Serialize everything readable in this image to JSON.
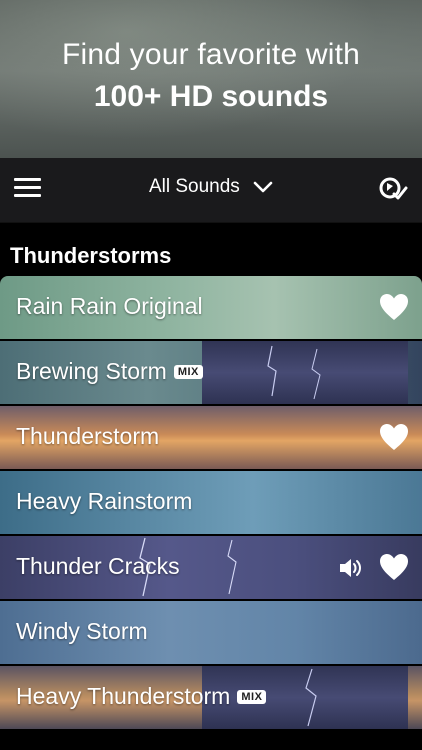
{
  "promo": {
    "line1": "Find your favorite with",
    "line2": "100+ HD sounds"
  },
  "navbar": {
    "title": "All Sounds"
  },
  "section": {
    "title": "Thunderstorms"
  },
  "sounds": [
    {
      "label": "Rain Rain Original",
      "favorite": true,
      "mix": false,
      "playing": false
    },
    {
      "label": "Brewing Storm",
      "favorite": false,
      "mix": true,
      "mix_label": "MIX",
      "playing": false
    },
    {
      "label": "Thunderstorm",
      "favorite": true,
      "mix": false,
      "playing": false
    },
    {
      "label": "Heavy Rainstorm",
      "favorite": false,
      "mix": false,
      "playing": false
    },
    {
      "label": "Thunder Cracks",
      "favorite": true,
      "mix": false,
      "playing": true
    },
    {
      "label": "Windy Storm",
      "favorite": false,
      "mix": false,
      "playing": false
    },
    {
      "label": "Heavy Thunderstorm",
      "favorite": false,
      "mix": true,
      "mix_label": "MIX",
      "playing": false
    }
  ],
  "colors": {
    "nav_bg": "#1a1a1c",
    "text": "#ffffff"
  }
}
